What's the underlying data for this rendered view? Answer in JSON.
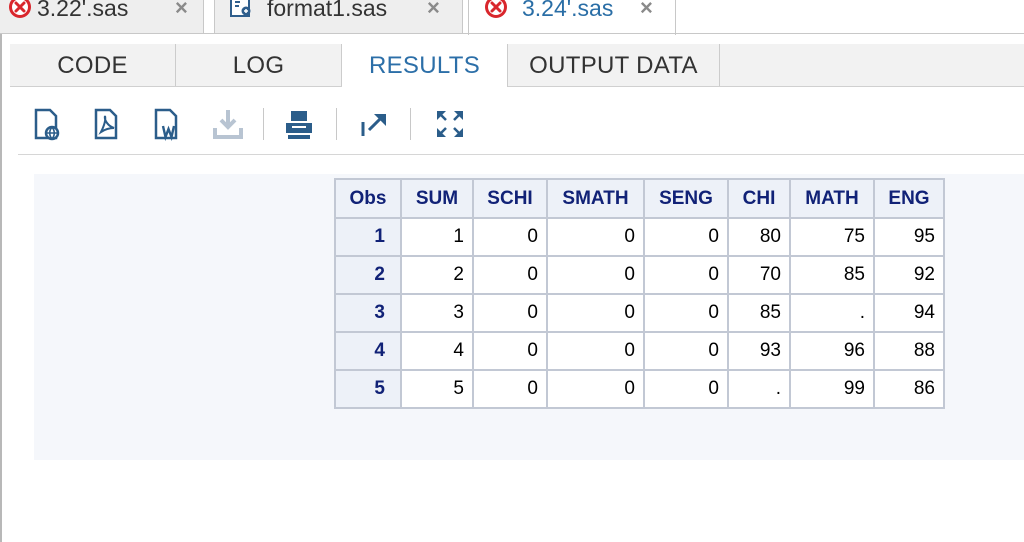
{
  "file_tabs": [
    {
      "name": "3.22'.sas",
      "icon": "error-icon",
      "close": "×",
      "active": false
    },
    {
      "name": "format1.sas",
      "icon": "program-icon",
      "close": "×",
      "active": false
    },
    {
      "name": "3.24'.sas",
      "icon": "error-icon",
      "close": "×",
      "active": true
    }
  ],
  "view_tabs": [
    "CODE",
    "LOG",
    "RESULTS",
    "OUTPUT DATA"
  ],
  "active_view_tab": "RESULTS",
  "toolbar": {
    "buttons": [
      {
        "icon": "html-download-icon"
      },
      {
        "icon": "pdf-download-icon"
      },
      {
        "icon": "rtf-download-icon"
      },
      {
        "icon": "download-icon",
        "disabled": true
      },
      {
        "icon": "print-icon"
      },
      {
        "icon": "open-new-window-icon"
      },
      {
        "icon": "maximize-icon"
      }
    ]
  },
  "results_table": {
    "columns": [
      "Obs",
      "SUM",
      "SCHI",
      "SMATH",
      "SENG",
      "CHI",
      "MATH",
      "ENG"
    ],
    "rows": [
      [
        "1",
        "1",
        "0",
        "0",
        "0",
        "80",
        "75",
        "95"
      ],
      [
        "2",
        "2",
        "0",
        "0",
        "0",
        "70",
        "85",
        "92"
      ],
      [
        "3",
        "3",
        "0",
        "0",
        "0",
        "85",
        ".",
        "94"
      ],
      [
        "4",
        "4",
        "0",
        "0",
        "0",
        "93",
        "96",
        "88"
      ],
      [
        "5",
        "5",
        "0",
        "0",
        "0",
        ".",
        "99",
        "86"
      ]
    ]
  },
  "colors": {
    "active_tab_text": "#2c6fa8",
    "header_text": "#112277",
    "header_bg": "#edf1f8",
    "error_icon": "#d9262c",
    "results_bg": "#f5f7fb"
  }
}
